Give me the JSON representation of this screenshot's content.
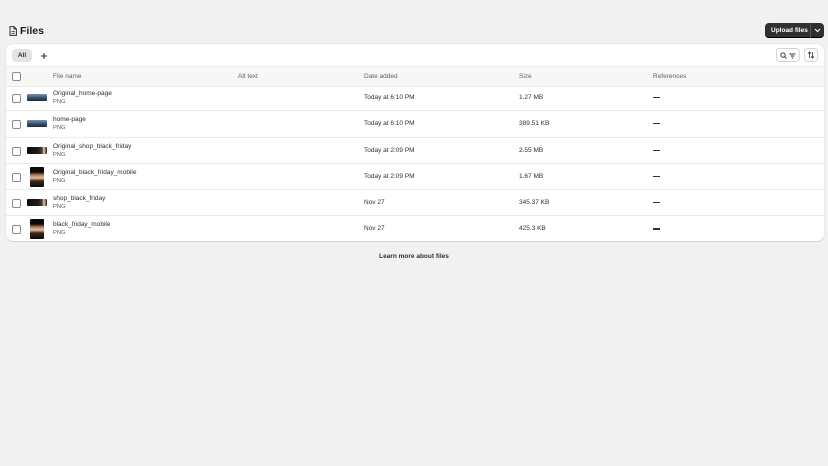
{
  "page": {
    "title": "Files",
    "title_icon": "file-icon",
    "upload_button": "Upload files"
  },
  "toolbar": {
    "tab_all": "All",
    "add_tab_icon": "plus-icon",
    "search_filter_icon": "search-filter-icon",
    "sort_icon": "sort-icon"
  },
  "table": {
    "columns": {
      "file_name": "File name",
      "alt_text": "Alt text",
      "date_added": "Date added",
      "size": "Size",
      "references": "References"
    },
    "rows": [
      {
        "name": "Original_home-page",
        "type": "PNG",
        "alt": "",
        "date": "Today at 6:10 PM",
        "size": "1.27 MB",
        "references": "—",
        "thumb": "wide-blue"
      },
      {
        "name": "home-page",
        "type": "PNG",
        "alt": "",
        "date": "Today at 6:10 PM",
        "size": "389.51 KB",
        "references": "—",
        "thumb": "wide-blue"
      },
      {
        "name": "Original_shop_black_friday",
        "type": "PNG",
        "alt": "",
        "date": "Today at 2:09 PM",
        "size": "2.55 MB",
        "references": "—",
        "thumb": "wide-dark"
      },
      {
        "name": "Original_black_friday_mobile",
        "type": "PNG",
        "alt": "",
        "date": "Today at 2:09 PM",
        "size": "1.67 MB",
        "references": "—",
        "thumb": "tall"
      },
      {
        "name": "shop_black_friday",
        "type": "PNG",
        "alt": "",
        "date": "Nov 27",
        "size": "345.37 KB",
        "references": "—",
        "thumb": "wide-dark"
      },
      {
        "name": "black_friday_mobile",
        "type": "PNG",
        "alt": "",
        "date": "Nov 27",
        "size": "425.3 KB",
        "references": "—",
        "thumb": "tall"
      }
    ]
  },
  "footer": {
    "learn_more": "Learn more about files"
  }
}
